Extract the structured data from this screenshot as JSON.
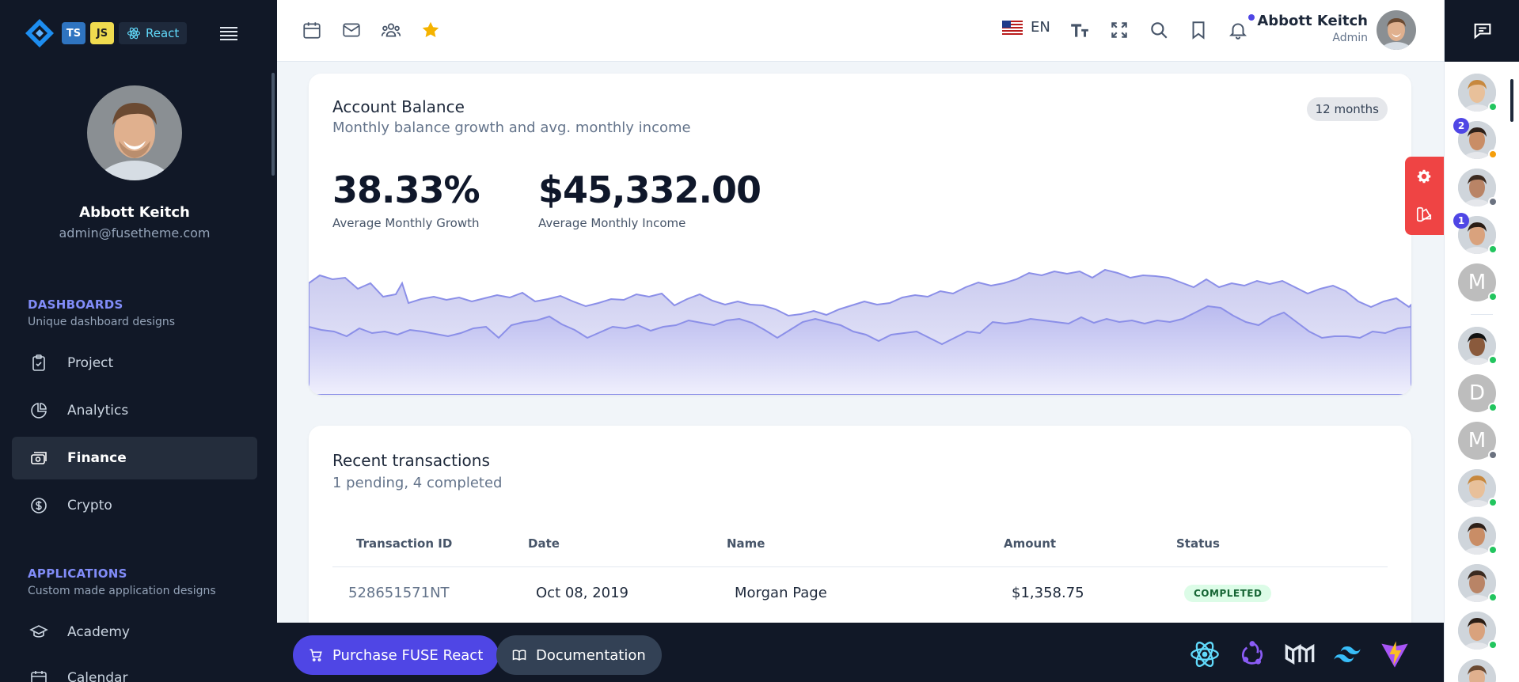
{
  "sidebar": {
    "badges": {
      "ts": "TS",
      "js": "JS",
      "react": "React"
    },
    "user": {
      "name": "Abbott Keitch",
      "email": "admin@fusetheme.com"
    },
    "sections": [
      {
        "title": "DASHBOARDS",
        "subtitle": "Unique dashboard designs"
      },
      {
        "title": "APPLICATIONS",
        "subtitle": "Custom made application designs"
      }
    ],
    "items": [
      {
        "label": "Project",
        "icon": "clipboard-check-icon"
      },
      {
        "label": "Analytics",
        "icon": "chart-pie-icon"
      },
      {
        "label": "Finance",
        "icon": "cash-icon",
        "active": true
      },
      {
        "label": "Crypto",
        "icon": "currency-dollar-icon"
      },
      {
        "label": "Academy",
        "icon": "academic-cap-icon"
      },
      {
        "label": "Calendar",
        "icon": "calendar-icon"
      }
    ]
  },
  "header": {
    "shortcuts": [
      "calendar-icon",
      "mail-icon",
      "users-icon",
      "star-icon"
    ],
    "language": "EN",
    "user": {
      "name": "Abbott Keitch",
      "role": "Admin"
    }
  },
  "balance_card": {
    "title": "Account Balance",
    "subtitle": "Monthly balance growth and avg. monthly income",
    "range_label": "12 months",
    "growth": {
      "value": "38.33%",
      "caption": "Average Monthly Growth"
    },
    "income": {
      "value": "$45,332.00",
      "caption": "Average Monthly Income"
    },
    "colors": {
      "series1": "#8b8fe8",
      "series2": "#b4b2e6"
    }
  },
  "transactions_card": {
    "title": "Recent transactions",
    "subtitle": "1 pending, 4 completed",
    "columns": [
      "Transaction ID",
      "Date",
      "Name",
      "Amount",
      "Status"
    ],
    "rows": [
      {
        "id": "528651571NT",
        "date": "Oct 08, 2019",
        "name": "Morgan Page",
        "amount": "$1,358.75",
        "status": "COMPLETED"
      }
    ]
  },
  "bottom_bar": {
    "purchase_label": "Purchase FUSE React",
    "docs_label": "Documentation",
    "tech_icons": [
      "react-icon",
      "redux-icon",
      "mui-icon",
      "tailwind-icon",
      "vite-icon"
    ]
  },
  "contacts": [
    {
      "kind": "photo",
      "status": "online"
    },
    {
      "kind": "photo",
      "status": "away",
      "unread": "2"
    },
    {
      "kind": "photo",
      "status": "offline"
    },
    {
      "kind": "photo",
      "status": "online",
      "unread": "1"
    },
    {
      "kind": "letter",
      "letter": "M",
      "status": "online"
    },
    {
      "kind": "photo",
      "status": "online"
    },
    {
      "kind": "letter",
      "letter": "D",
      "status": "online"
    },
    {
      "kind": "letter",
      "letter": "M",
      "status": "offline"
    },
    {
      "kind": "photo",
      "status": "online"
    },
    {
      "kind": "photo",
      "status": "online"
    },
    {
      "kind": "photo",
      "status": "online"
    },
    {
      "kind": "photo",
      "status": "online"
    },
    {
      "kind": "photo",
      "status": "online"
    }
  ]
}
